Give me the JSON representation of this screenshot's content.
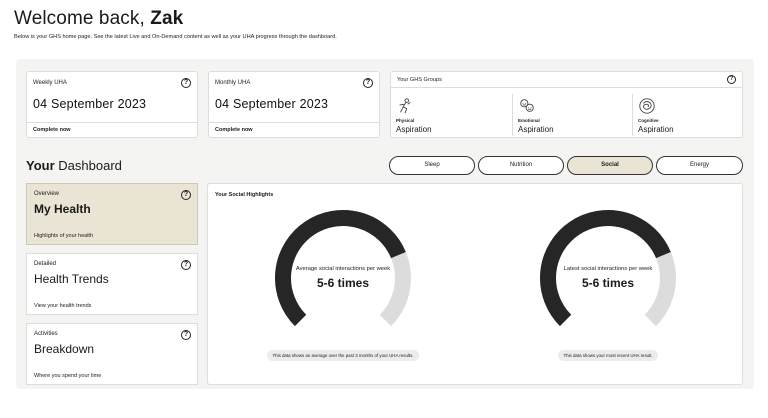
{
  "header": {
    "welcome_prefix": "Welcome back,",
    "user_name": "Zak",
    "subtitle": "Below is your GHS home page. See the latest Live and On-Demand content as well as your UHA progress through the dashboard."
  },
  "uha": {
    "weekly": {
      "label": "Weekly UHA",
      "date": "04 September 2023",
      "action": "Complete now"
    },
    "monthly": {
      "label": "Monthly UHA",
      "date": "04 September 2023",
      "action": "Complete now"
    }
  },
  "ghs_groups": {
    "title": "Your GHS Groups",
    "items": [
      {
        "category": "Physical",
        "name": "Aspiration",
        "icon": "physical-icon"
      },
      {
        "category": "Emotional",
        "name": "Aspiration",
        "icon": "emotional-icon"
      },
      {
        "category": "Cognitive",
        "name": "Aspiration",
        "icon": "cognitive-icon"
      }
    ]
  },
  "dashboard": {
    "title_bold": "Your",
    "title_rest": "Dashboard",
    "tabs": [
      {
        "label": "Sleep",
        "active": false
      },
      {
        "label": "Nutrition",
        "active": false
      },
      {
        "label": "Social",
        "active": true
      },
      {
        "label": "Energy",
        "active": false
      }
    ],
    "side_cards": [
      {
        "label": "Overview",
        "title": "My Health",
        "foot": "Highlights of your health",
        "active": true
      },
      {
        "label": "Detailed",
        "title": "Health Trends",
        "foot": "View your health trends",
        "active": false
      },
      {
        "label": "Activities",
        "title": "Breakdown",
        "foot": "Where you spend your time",
        "active": false
      }
    ]
  },
  "social_highlights": {
    "title": "Your Social Highlights",
    "gauges": [
      {
        "label": "Average social interactions per week",
        "value": "5-6 times",
        "note": "This data shows an average over the past 3 months of your UHA results.",
        "fill": 0.75
      },
      {
        "label": "Latest social interactions per week",
        "value": "5-6 times",
        "note": "This data shows your most recent UHA result.",
        "fill": 0.75
      }
    ]
  },
  "colors": {
    "accent": "#e9e4d4",
    "gauge_fill": "#262626",
    "gauge_track": "#dcdcdc"
  }
}
